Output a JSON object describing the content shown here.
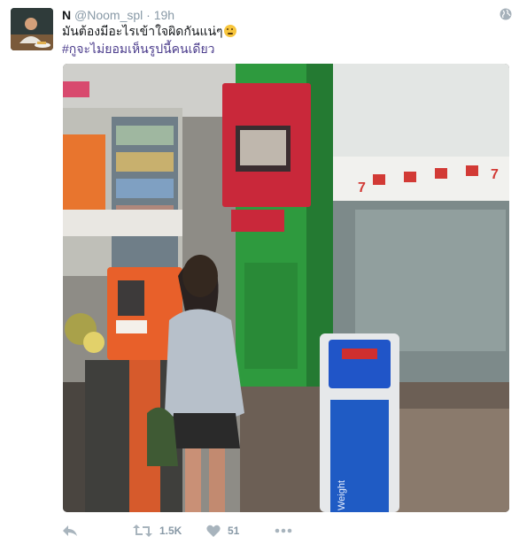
{
  "tweet": {
    "display_name": "N",
    "handle": "@Noom_spl",
    "separator": "·",
    "timestamp": "19h",
    "text_line1": "มันต้องมีอะไรเข้าใจผิดกันแน่ๆ",
    "text_line2": "#กูจะไม่ยอมเห็นรูปนี้คนเดียว",
    "emoji": "thinking-face-emoji"
  },
  "photo": {
    "atm_brand_sign": "7",
    "scale_label": "Weight",
    "colors": {
      "green_atm": "#2e9a3e",
      "red_atm": "#c9283a",
      "orange_atm": "#e8602a",
      "scale_blue": "#1f5bc4"
    }
  },
  "actions": {
    "reply_icon": "reply-icon",
    "retweet_icon": "retweet-icon",
    "retweet_count": "1.5K",
    "like_icon": "heart-icon",
    "like_count": "51",
    "more_icon": "more-dots-icon"
  },
  "colors": {
    "text": "#14171a",
    "secondary": "#8899a6",
    "hashtag": "#4b3c8c"
  }
}
